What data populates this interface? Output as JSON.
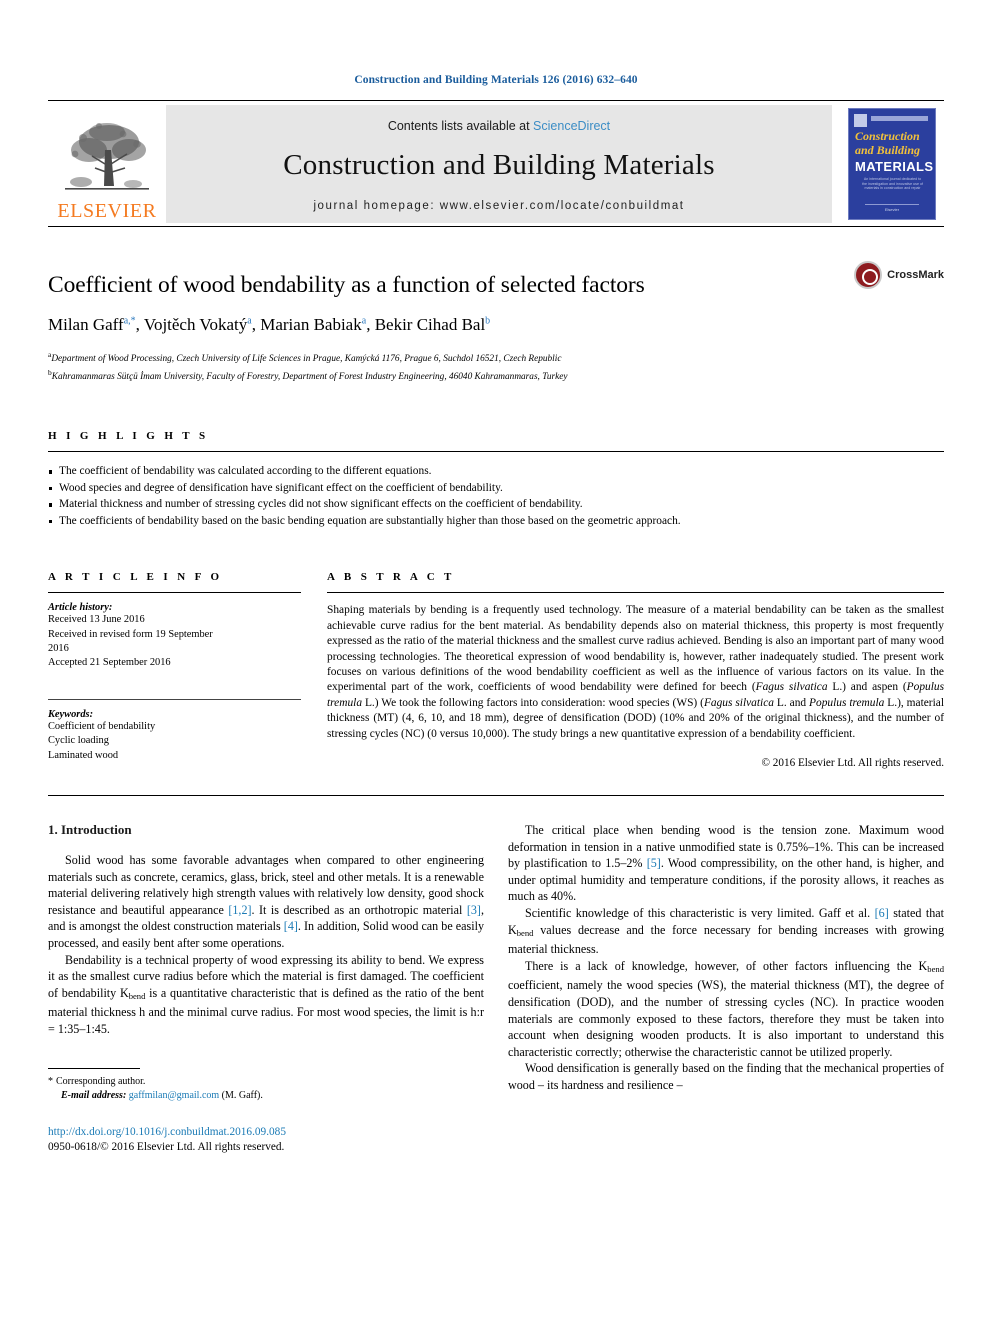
{
  "running_head": "Construction and Building Materials 126 (2016) 632–640",
  "masthead": {
    "publisher_name": "ELSEVIER",
    "contents_prefix": "Contents lists available at ",
    "contents_link": "ScienceDirect",
    "journal_name": "Construction and Building Materials",
    "homepage": "journal homepage: www.elsevier.com/locate/conbuildmat",
    "cover": {
      "line1": "Construction",
      "line2": "and Building",
      "line3": "MATERIALS",
      "blurb": "An international journal dedicated to the investigation and innovative use of materials in construction and repair",
      "footer": "Elsevier"
    }
  },
  "title_block": {
    "title": "Coefficient of wood bendability as a function of selected factors",
    "crossmark_label": "CrossMark",
    "authors": [
      {
        "name": "Milan Gaff",
        "marks": "a,*"
      },
      {
        "name": "Vojtěch Vokatý",
        "marks": "a"
      },
      {
        "name": "Marian Babiak",
        "marks": "a"
      },
      {
        "name": "Bekir Cihad Bal",
        "marks": "b"
      }
    ],
    "affiliations": [
      {
        "mark": "a",
        "text": "Department of Wood Processing, Czech University of Life Sciences in Prague, Kamýcká 1176, Prague 6, Suchdol 16521, Czech Republic"
      },
      {
        "mark": "b",
        "text": "Kahramanmaras Sütçü İmam University, Faculty of Forestry, Department of Forest Industry Engineering, 46040 Kahramanmaras, Turkey"
      }
    ]
  },
  "highlights": {
    "heading": "H I G H L I G H T S",
    "items": [
      "The coefficient of bendability was calculated according to the different equations.",
      "Wood species and degree of densification have significant effect on the coefficient of bendability.",
      "Material thickness and number of stressing cycles did not show significant effects on the coefficient of bendability.",
      "The coefficients of bendability based on the basic bending equation are substantially higher than those based on the geometric approach."
    ]
  },
  "article_info": {
    "heading": "A R T I C L E  I N F O",
    "history_label": "Article history:",
    "history_lines": [
      "Received 13 June 2016",
      "Received in revised form 19 September",
      "2016",
      "Accepted 21 September 2016"
    ],
    "keywords_label": "Keywords:",
    "keywords": [
      "Coefficient of bendability",
      "Cyclic loading",
      "Laminated wood"
    ]
  },
  "abstract": {
    "heading": "A B S T R A C T",
    "paragraph_part1": "Shaping materials by bending is a frequently used technology. The measure of a material bendability can be taken as the smallest achievable curve radius for the bent material. As bendability depends also on material thickness, this property is most frequently expressed as the ratio of the material thickness and the smallest curve radius achieved. Bending is also an important part of many wood processing technologies. The theoretical expression of wood bendability is, however, rather inadequately studied. The present work focuses on various definitions of the wood bendability coefficient as well as the influence of various factors on its value. In the experimental part of the work, coefficients of wood bendability were defined for beech (",
    "italic1": "Fagus silvatica",
    "paragraph_part2": " L.) and aspen (",
    "italic2": "Populus tremula",
    "paragraph_part3": " L.) We took the following factors into consideration: wood species (WS) (",
    "italic3": "Fagus silvatica",
    "paragraph_part4": " L. and ",
    "italic4": "Populus tremula",
    "paragraph_part5": " L.), material thickness (MT) (4, 6, 10, and 18 mm), degree of densification (DOD) (10% and 20% of the original thickness), and the number of stressing cycles (NC) (0 versus 10,000). The study brings a new quantitative expression of a bendability coefficient.",
    "copyright": "© 2016 Elsevier Ltd. All rights reserved."
  },
  "intro": {
    "section_title": "1. Introduction",
    "left": {
      "p1_a": "Solid wood has some favorable advantages when compared to other engineering materials such as concrete, ceramics, glass, brick, steel and other metals. It is a renewable material delivering relatively high strength values with relatively low density, good shock resistance and beautiful appearance ",
      "p1_ref1": "[1,2]",
      "p1_b": ". It is described as an orthotropic material ",
      "p1_ref2": "[3]",
      "p1_c": ", and is amongst the oldest construction materials ",
      "p1_ref3": "[4]",
      "p1_d": ". In addition, Solid wood can be easily processed, and easily bent after some operations.",
      "p2_a": "Bendability is a technical property of wood expressing its ability to bend. We express it as the smallest curve radius before which the material is first damaged. The coefficient of bendability K",
      "p2_sub": "bend",
      "p2_b": " is a quantitative characteristic that is defined as the ratio of the bent material thickness h and the minimal curve radius. For most wood species, the limit is h:r = 1:35–1:45."
    },
    "right": {
      "p1_a": "The critical place when bending wood is the tension zone. Maximum wood deformation in tension in a native unmodified state is 0.75%–1%. This can be increased by plastification to 1.5–2% ",
      "p1_ref1": "[5]",
      "p1_b": ". Wood compressibility, on the other hand, is higher, and under optimal humidity and temperature conditions, if the porosity allows, it reaches as much as 40%.",
      "p2_a": "Scientific knowledge of this characteristic is very limited. Gaff et al. ",
      "p2_ref1": "[6]",
      "p2_b": " stated that K",
      "p2_sub": "bend",
      "p2_c": " values decrease and the force necessary for bending increases with growing material thickness.",
      "p3_a": "There is a lack of knowledge, however, of other factors influencing the K",
      "p3_sub": "bend",
      "p3_b": " coefficient, namely the wood species (WS), the material thickness (MT), the degree of densification (DOD), and the number of stressing cycles (NC). In practice wooden materials are commonly exposed to these factors, therefore they must be taken into account when designing wooden products. It is also important to understand this characteristic correctly; otherwise the characteristic cannot be utilized properly.",
      "p4": "Wood densification is generally based on the finding that the mechanical properties of wood – its hardness and resilience –"
    }
  },
  "footnote": {
    "star": "*",
    "corresponding": "Corresponding author.",
    "email_label": "E-mail address:",
    "email": "gaffmilan@gmail.com",
    "email_suffix": "(M. Gaff)."
  },
  "footer": {
    "doi": "http://dx.doi.org/10.1016/j.conbuildmat.2016.09.085",
    "issn": "0950-0618/© 2016 Elsevier Ltd. All rights reserved."
  },
  "colors": {
    "link_blue": "#1a7ab5",
    "header_blue": "#1a5c9c",
    "elsevier_orange": "#f47a20",
    "band_gray": "#e6e6e6",
    "cover_blue": "#2b3f9e",
    "crossmark_red": "#8e1c20"
  }
}
